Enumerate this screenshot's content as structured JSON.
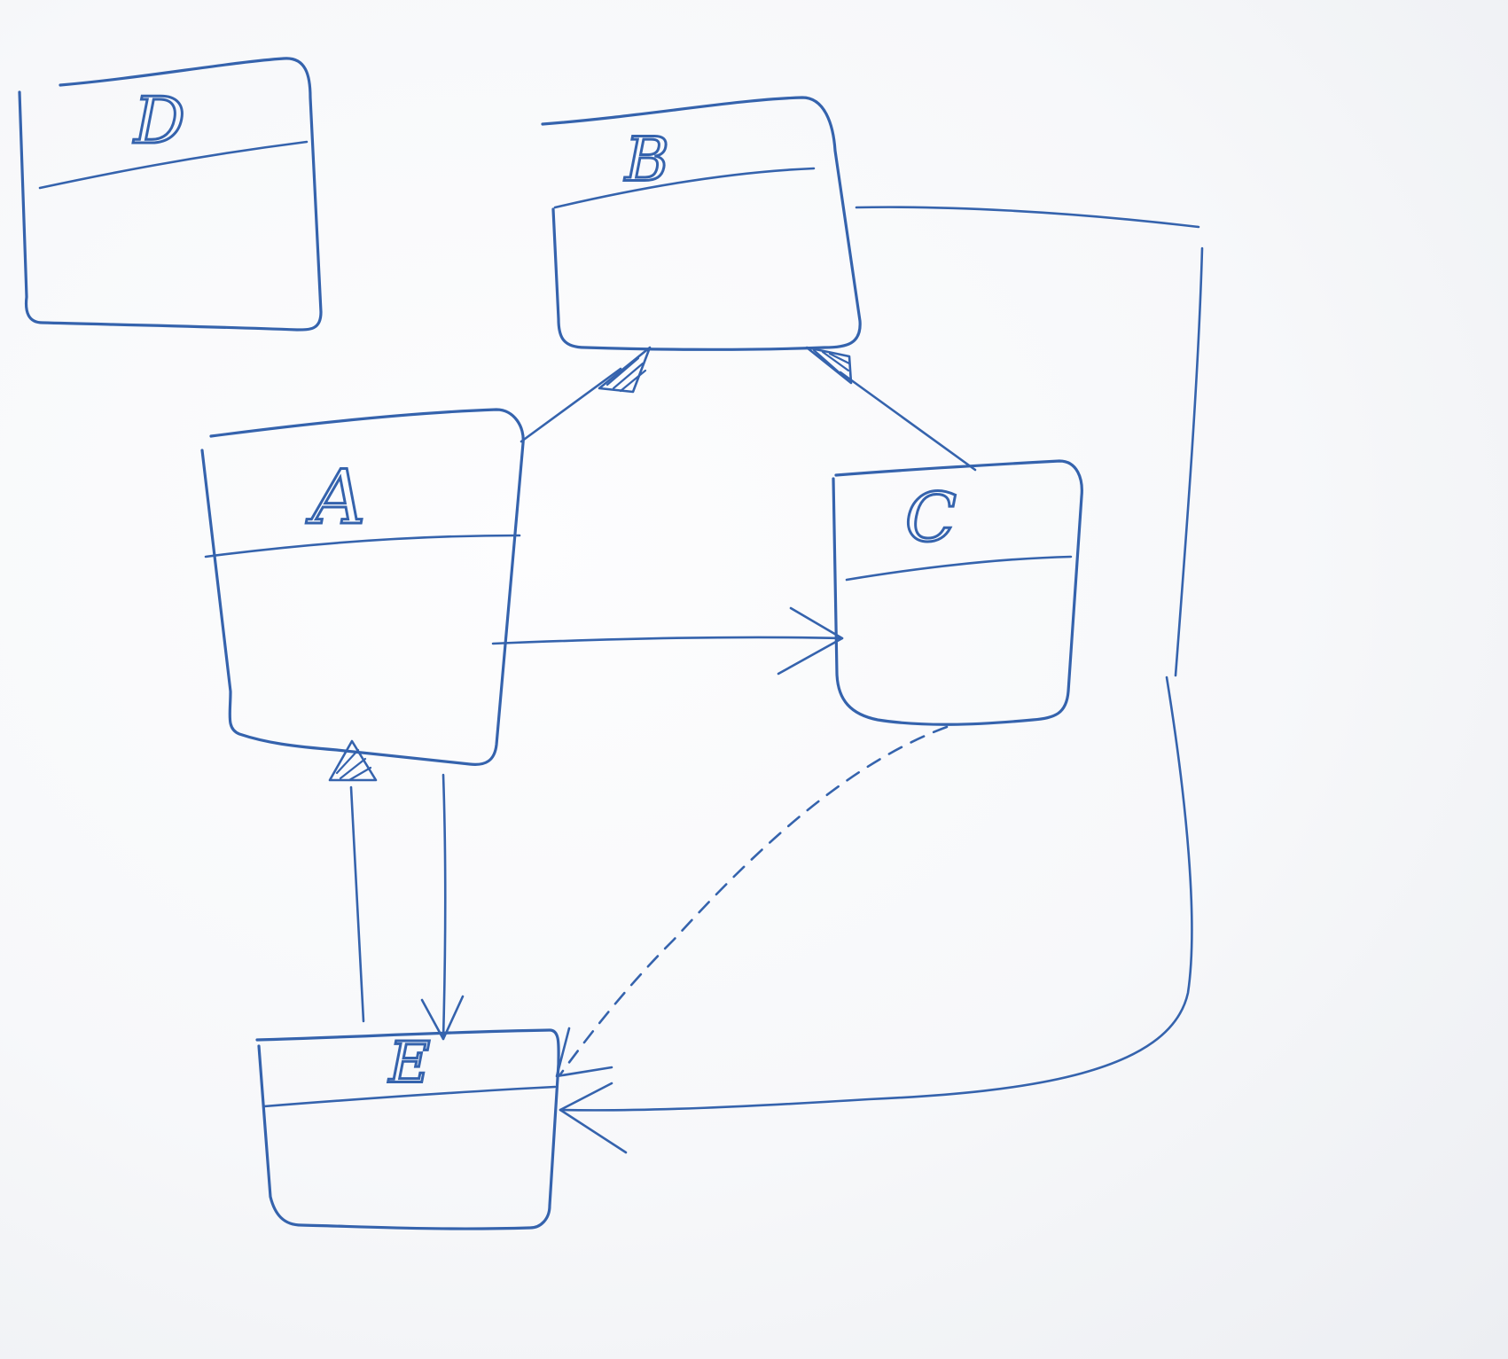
{
  "colors": {
    "ink": "#3563ad",
    "ink_light": "#6f93cc",
    "board": "#f8f9fb"
  },
  "classes": [
    {
      "id": "D",
      "label": "D"
    },
    {
      "id": "B",
      "label": "B"
    },
    {
      "id": "A",
      "label": "A"
    },
    {
      "id": "C",
      "label": "C"
    },
    {
      "id": "E",
      "label": "E"
    }
  ],
  "relations": [
    {
      "from": "A",
      "to": "B",
      "kind": "generalization"
    },
    {
      "from": "C",
      "to": "B",
      "kind": "generalization"
    },
    {
      "from": "A",
      "to": "C",
      "kind": "association"
    },
    {
      "from": "E",
      "to": "A",
      "kind": "generalization"
    },
    {
      "from": "A",
      "to": "E",
      "kind": "association"
    },
    {
      "from": "C",
      "to": "E",
      "kind": "dependency"
    },
    {
      "from": "B",
      "to": "E",
      "kind": "association"
    }
  ]
}
